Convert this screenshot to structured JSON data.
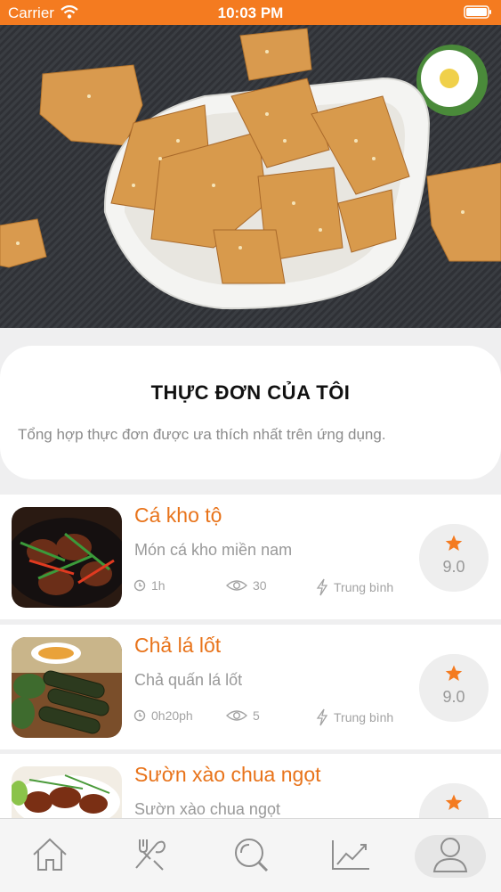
{
  "status_bar": {
    "carrier": "Carrier",
    "time": "10:03 PM"
  },
  "hero": {
    "image": "fried-sesame-crackers-photo"
  },
  "header": {
    "title": "THỰC ĐƠN CỦA TÔI",
    "subtitle": "Tổng hợp thực đơn được ưa thích nhất trên ứng dụng."
  },
  "recipes": [
    {
      "name": "Cá kho tộ",
      "description": "Món cá kho miền nam",
      "time": "1h",
      "views": "30",
      "difficulty": "Trung bình",
      "rating": "9.0",
      "image": "fish-claypot-photo"
    },
    {
      "name": "Chả lá lốt",
      "description": "Chả quấn lá lốt",
      "time": "0h20ph",
      "views": "5",
      "difficulty": "Trung bình",
      "rating": "9.0",
      "image": "betel-leaf-rolls-photo"
    },
    {
      "name": "Sườn xào chua ngọt",
      "description": "Sườn xào chua ngọt",
      "image": "sweet-sour-ribs-photo"
    }
  ],
  "tab_bar": {
    "items": [
      "home-icon",
      "utensils-icon",
      "search-icon",
      "chart-icon",
      "profile-icon"
    ],
    "active": "profile-icon"
  },
  "colors": {
    "accent": "#f47b20",
    "title_orange": "#e8731a",
    "muted": "#999999"
  }
}
